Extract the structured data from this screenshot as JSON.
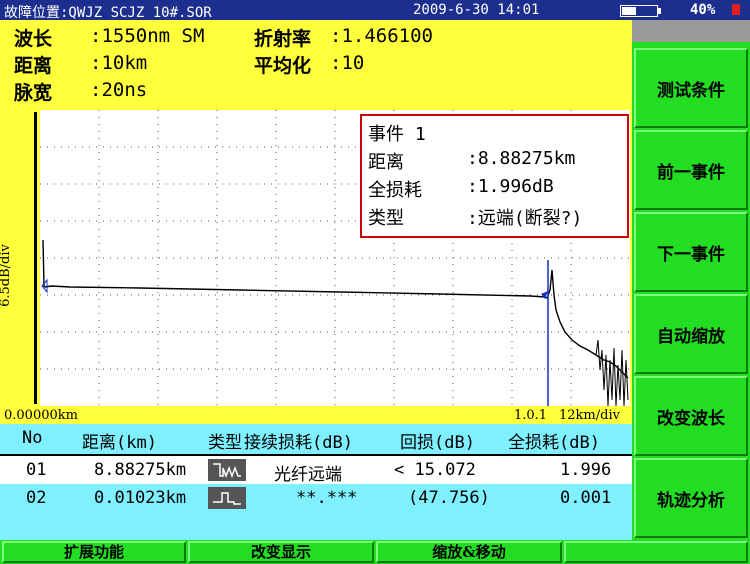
{
  "titlebar": {
    "file": "故障位置:QWJZ SCJZ_10#.SOR",
    "datetime": "2009-6-30 14:01",
    "battery_text": "40%",
    "battery_level": 0.4
  },
  "info": {
    "wavelength_label": "波长",
    "wavelength_value": ":1550nm SM",
    "ior_label": "折射率",
    "ior_value": ":1.466100",
    "distance_label": "距离",
    "distance_value": ":10km",
    "avg_label": "平均化",
    "avg_value": ":10",
    "pulse_label": "脉宽",
    "pulse_value": ":20ns"
  },
  "plot": {
    "y_scale": "6.5dB/div",
    "x_start": "0.00000km",
    "x_marker": "1.0.1",
    "x_scale": "12km/div"
  },
  "event_box": {
    "title": "事件 1",
    "distance_label": "距离",
    "distance_value": ":8.88275km",
    "loss_label": "全损耗",
    "loss_value": ":1.996dB",
    "type_label": "类型",
    "type_value": ":远端(断裂?)"
  },
  "table": {
    "headers": [
      "No",
      "距离(km)",
      "类型",
      "接续损耗(dB)",
      "回损(dB)",
      "全损耗(dB)"
    ],
    "rows": [
      {
        "no": "01",
        "distance": "8.88275km",
        "icon": "far-end-icon",
        "splice": "光纤远端",
        "return_loss": "< 15.072",
        "total": "1.996"
      },
      {
        "no": "02",
        "distance": "0.01023km",
        "icon": "reflective-event-icon",
        "splice": "**.***",
        "return_loss": "(47.756)",
        "total": "0.001"
      }
    ]
  },
  "softkeys": [
    "测试条件",
    "前一事件",
    "下一事件",
    "自动缩放",
    "改变波长",
    "轨迹分析"
  ],
  "bottom_keys": [
    "扩展功能",
    "改变显示",
    "缩放&移动",
    ""
  ],
  "colors": {
    "title_bg": "#1c2f8e",
    "info_bg": "#ffff3c",
    "table_bg": "#7ff0ff",
    "softkey_bg": "#22dd22",
    "event_border": "#cc0000"
  }
}
